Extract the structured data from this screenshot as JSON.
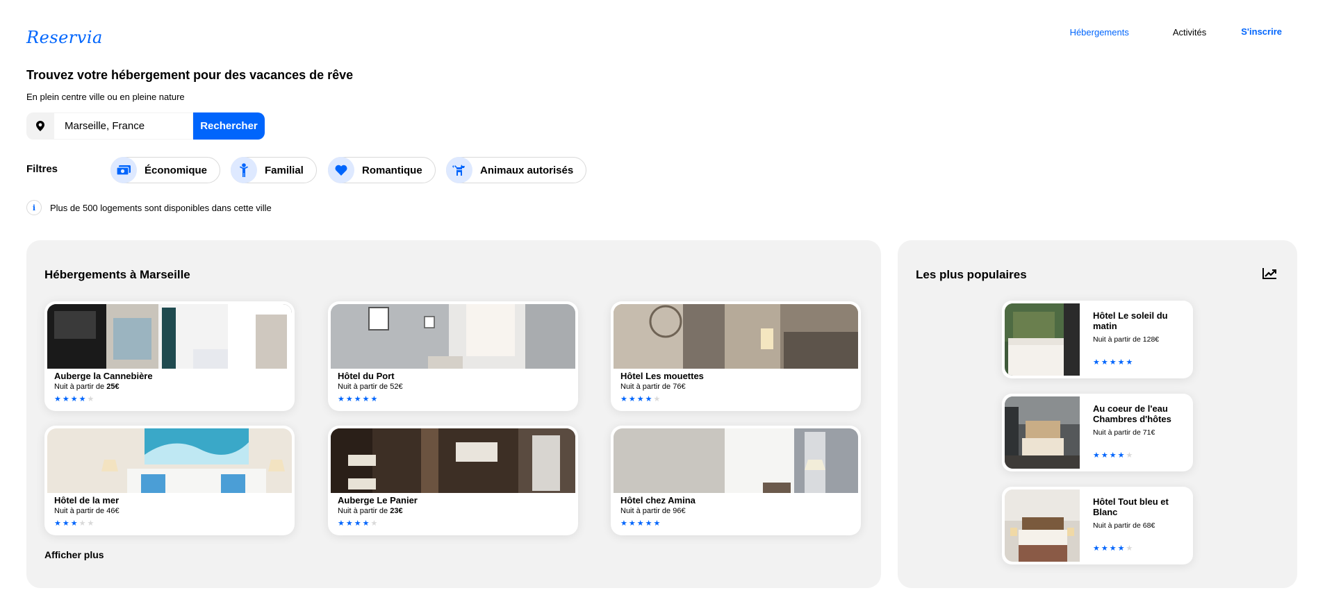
{
  "header": {
    "logo": "Reservia",
    "nav": [
      "Hébergements",
      "Activités",
      "S'inscrire"
    ]
  },
  "hero": {
    "title": "Trouvez votre hébergement pour des vacances de rêve",
    "subtitle": "En plein centre ville ou en pleine nature"
  },
  "search": {
    "value": "Marseille, France",
    "button": "Rechercher",
    "icon": "location-pin-icon"
  },
  "filters": {
    "label": "Filtres",
    "chips": [
      {
        "label": "Économique",
        "icon": "money-icon"
      },
      {
        "label": "Familial",
        "icon": "child-icon"
      },
      {
        "label": "Romantique",
        "icon": "heart-icon"
      },
      {
        "label": "Animaux autorisés",
        "icon": "dog-icon"
      }
    ]
  },
  "info": {
    "icon": "info-icon",
    "text": "Plus de 500 logements sont disponibles dans cette ville"
  },
  "listings": {
    "title": "Hébergements à Marseille",
    "cards": [
      {
        "name": "Auberge la Cannebière",
        "price_prefix": "Nuit à partir de ",
        "price": "25€",
        "price_bold": true,
        "rating": 4
      },
      {
        "name": "Hôtel du Port",
        "price_prefix": "Nuit à partir de ",
        "price": "52€",
        "price_bold": false,
        "rating": 5
      },
      {
        "name": "Hôtel Les mouettes",
        "price_prefix": "Nuit à partir de ",
        "price": "76€",
        "price_bold": false,
        "rating": 4
      },
      {
        "name": "Hôtel de la mer",
        "price_prefix": "Nuit à partir de ",
        "price": "46€",
        "price_bold": false,
        "rating": 3
      },
      {
        "name": "Auberge Le Panier",
        "price_prefix": "Nuit à partir de ",
        "price": "23€",
        "price_bold": true,
        "rating": 4
      },
      {
        "name": "Hôtel chez Amina",
        "price_prefix": "Nuit à partir de ",
        "price": "96€",
        "price_bold": false,
        "rating": 5
      }
    ],
    "more": "Afficher plus"
  },
  "popular": {
    "title": "Les plus populaires",
    "icon": "trend-chart-icon",
    "items": [
      {
        "name": "Hôtel Le soleil du matin",
        "price": "Nuit à partir de 128€",
        "rating": 5
      },
      {
        "name": "Au coeur de l'eau Chambres d'hôtes",
        "price": "Nuit à partir de 71€",
        "rating": 4
      },
      {
        "name": "Hôtel Tout bleu et Blanc",
        "price": "Nuit à partir de 68€",
        "rating": 4
      }
    ]
  },
  "colors": {
    "accent": "#0065fc",
    "accent_light": "#dee9ff",
    "panel_bg": "#f2f2f2",
    "star_off": "#d9d9d9"
  }
}
